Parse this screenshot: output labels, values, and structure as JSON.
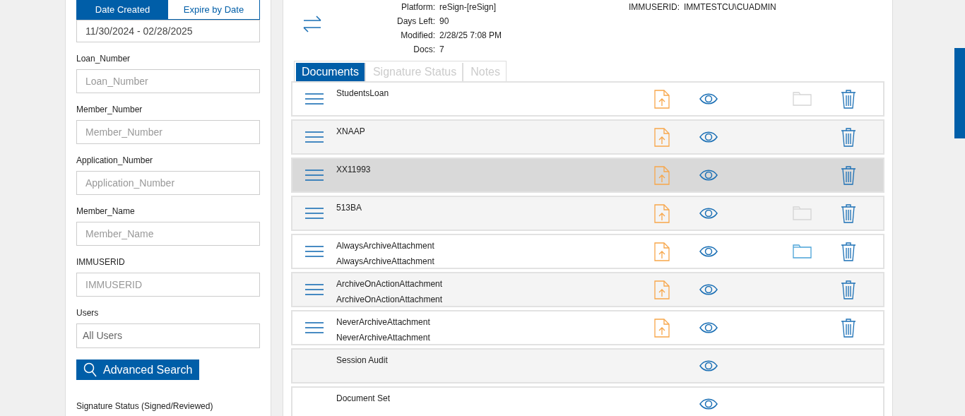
{
  "filters_panel": {
    "date_tabs": [
      {
        "label": "Date Created",
        "selected": true
      },
      {
        "label": "Expire by Date",
        "selected": false
      }
    ],
    "date_range": "11/30/2024 - 02/28/2025",
    "fields": [
      {
        "label": "Loan_Number",
        "placeholder": "Loan_Number"
      },
      {
        "label": "Member_Number",
        "placeholder": "Member_Number"
      },
      {
        "label": "Application_Number",
        "placeholder": "Application_Number"
      },
      {
        "label": "Member_Name",
        "placeholder": "Member_Name"
      },
      {
        "label": "IMMUSERID",
        "placeholder": "IMMUSERID"
      },
      {
        "label": "Users",
        "value": "All Users"
      }
    ],
    "search_button": "Advanced Search",
    "section_label": "Signature Status (Signed/Reviewed)"
  },
  "details": [
    {
      "label": "Platform:",
      "value": "reSign-[reSign]"
    },
    {
      "label": "Days Left:",
      "value": "90"
    },
    {
      "label": "Modified:",
      "value": "2/28/25 7:08 PM"
    },
    {
      "label": "Docs:",
      "value": "7"
    }
  ],
  "details_right": [
    {
      "label": "IMMUSERID:",
      "value": "IMMTESTCU\\CUADMIN"
    }
  ],
  "tabs": [
    {
      "label": "Documents",
      "selected": true
    },
    {
      "label": "Signature Status",
      "selected": false
    },
    {
      "label": "Notes",
      "selected": false
    }
  ],
  "documents": [
    {
      "kind": "document",
      "name": "StudentsLoan",
      "selected": false,
      "folder": {
        "enabled": false
      }
    },
    {
      "kind": "document",
      "name": "XNAAP",
      "selected": false
    },
    {
      "kind": "document",
      "name": "XX11993",
      "selected": true
    },
    {
      "kind": "document",
      "name": "513BA",
      "selected": false,
      "folder": {
        "enabled": false
      }
    },
    {
      "kind": "document",
      "name": "AlwaysArchiveAttachment",
      "subtitle": "AlwaysArchiveAttachment",
      "selected": false,
      "folder": {
        "enabled": true
      }
    },
    {
      "kind": "document",
      "name": "ArchiveOnActionAttachment",
      "subtitle": "ArchiveOnActionAttachment",
      "selected": false
    },
    {
      "kind": "document",
      "name": "NeverArchiveAttachment",
      "subtitle": "NeverArchiveAttachment",
      "selected": false
    },
    {
      "kind": "audit",
      "name": "Session Audit",
      "selected": false
    },
    {
      "kind": "set",
      "name": "Document Set",
      "selected": false
    }
  ]
}
